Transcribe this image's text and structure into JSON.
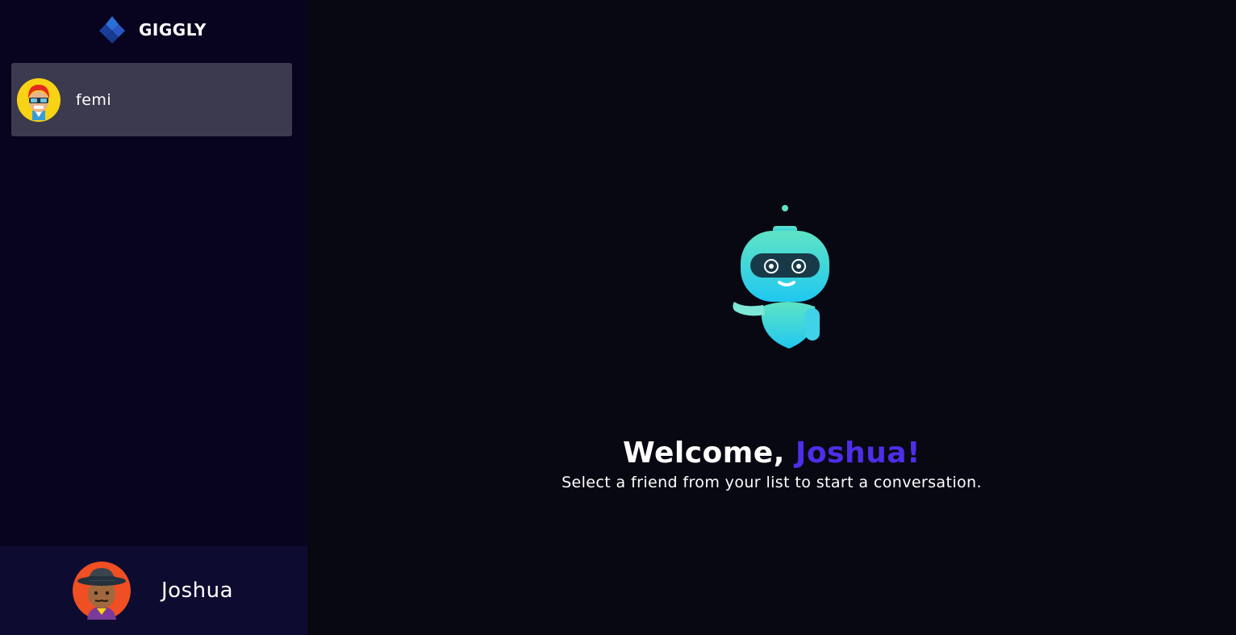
{
  "app": {
    "brand": "GIGGLY",
    "colors": {
      "sidebar": "#080420",
      "main": "#080812",
      "contact_selected": "#3c3a4e",
      "user_panel": "#0d0c30",
      "accent": "#4e2ee8"
    }
  },
  "sidebar": {
    "logo_icon": "diamond-logo-icon",
    "contacts": [
      {
        "name": "femi",
        "avatar": "avatar-red-hair-sunglasses"
      }
    ],
    "current_user": {
      "name": "Joshua",
      "avatar": "avatar-fedora-hat"
    }
  },
  "main": {
    "illustration": "robot-waving",
    "welcome_prefix": "Welcome, ",
    "welcome_name": "Joshua!",
    "subtitle": "Select a friend from your list to start a conversation."
  }
}
